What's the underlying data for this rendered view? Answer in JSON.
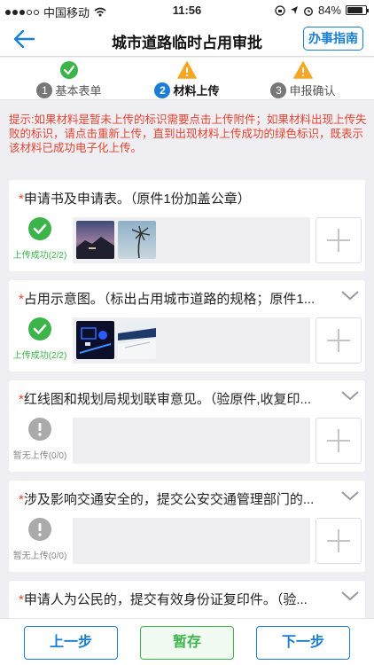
{
  "status_bar": {
    "carrier": "中国移动",
    "time": "11:56",
    "battery": "84%"
  },
  "nav": {
    "title": "城市道路临时占用审批",
    "guide_label": "办事指南"
  },
  "steps": [
    {
      "num": "1",
      "label": "基本表单",
      "state_icon": "check-icon"
    },
    {
      "num": "2",
      "label": "材料上传",
      "state_icon": "warning-icon"
    },
    {
      "num": "3",
      "label": "申报确认",
      "state_icon": "warning-icon"
    }
  ],
  "hint": "提示:如果材料是暂未上传的标识需要点击上传附件；如果材料出现上传失败的标识，请点击重新上传，直到出现材料上传成功的绿色标识，既表示该材料已成功电子化上传。",
  "items": [
    {
      "required": "*",
      "title": "申请书及申请表。（原件1份加盖公章）",
      "status": "上传成功(2/2)",
      "state": "ok"
    },
    {
      "required": "*",
      "title": "占用示意图。（标出占用城市道路的规格；原件1...",
      "status": "上传成功(2/2)",
      "state": "ok"
    },
    {
      "required": "*",
      "title": "红线图和规划局规划联审意见。（验原件,收复印...",
      "status": "暂无上传(0/0)",
      "state": "none"
    },
    {
      "required": "*",
      "title": "涉及影响交通安全的，提交公安交通管理部门的...",
      "status": "暂无上传(0/0)",
      "state": "none"
    },
    {
      "required": "*",
      "title": "申请人为公民的，提交有效身份证复印件。（验...",
      "status": "",
      "state": "none"
    }
  ],
  "bottom": {
    "prev_label": "上一步",
    "save_label": "暂存",
    "next_label": "下一步"
  },
  "colors": {
    "accent": "#1a7fd4",
    "success": "#3bb44a",
    "warning": "#f5a623",
    "hint": "#e8432f"
  }
}
